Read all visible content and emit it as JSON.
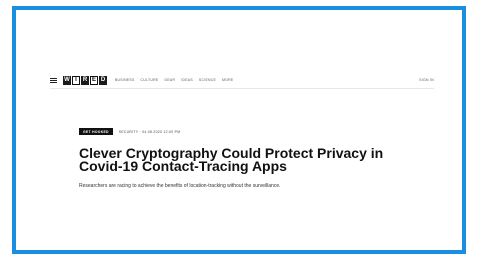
{
  "header": {
    "logo_letters": [
      "W",
      "I",
      "R",
      "E",
      "D"
    ],
    "nav_items": [
      "Business",
      "Culture",
      "Gear",
      "Ideas",
      "Science",
      "More"
    ],
    "signin_label": "Sign In"
  },
  "article": {
    "section_tag": "Get Hooked",
    "byline": "Security  ·  04.08.2020 12:00 PM",
    "headline": "Clever Cryptography Could Protect Privacy in Covid-19 Contact-Tracing Apps",
    "dek": "Researchers are racing to achieve the benefits of location-tracking without the surveillance."
  },
  "colors": {
    "frame_border": "#1a8fe0",
    "text": "#111111"
  }
}
